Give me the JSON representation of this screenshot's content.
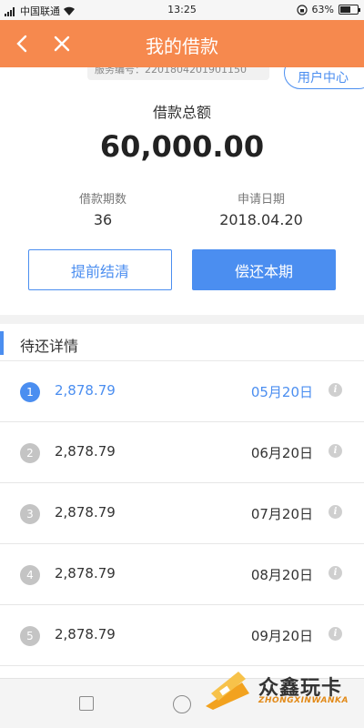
{
  "status_bar": {
    "carrier": "中国联通",
    "time": "13:25",
    "battery": "63%",
    "battery_level": 0.63
  },
  "nav": {
    "title": "我的借款"
  },
  "summary": {
    "service_no": "服务编号：2201804201901150",
    "user_center": "用户中心",
    "total_label": "借款总额",
    "total_amount": "60,000.00",
    "periods_label": "借款期数",
    "periods_value": "36",
    "date_label": "申请日期",
    "date_value": "2018.04.20",
    "prepay_button": "提前结清",
    "repay_button": "偿还本期"
  },
  "details": {
    "title": "待还详情",
    "rows": [
      {
        "num": "1",
        "amount": "2,878.79",
        "date": "05月20日"
      },
      {
        "num": "2",
        "amount": "2,878.79",
        "date": "06月20日"
      },
      {
        "num": "3",
        "amount": "2,878.79",
        "date": "07月20日"
      },
      {
        "num": "4",
        "amount": "2,878.79",
        "date": "08月20日"
      },
      {
        "num": "5",
        "amount": "2,878.79",
        "date": "09月20日"
      }
    ]
  },
  "watermark": {
    "name": "众鑫玩卡",
    "sub": "ZHONGXINWANKA"
  },
  "colors": {
    "accent": "#f6894e",
    "primary": "#4b8ef0"
  }
}
